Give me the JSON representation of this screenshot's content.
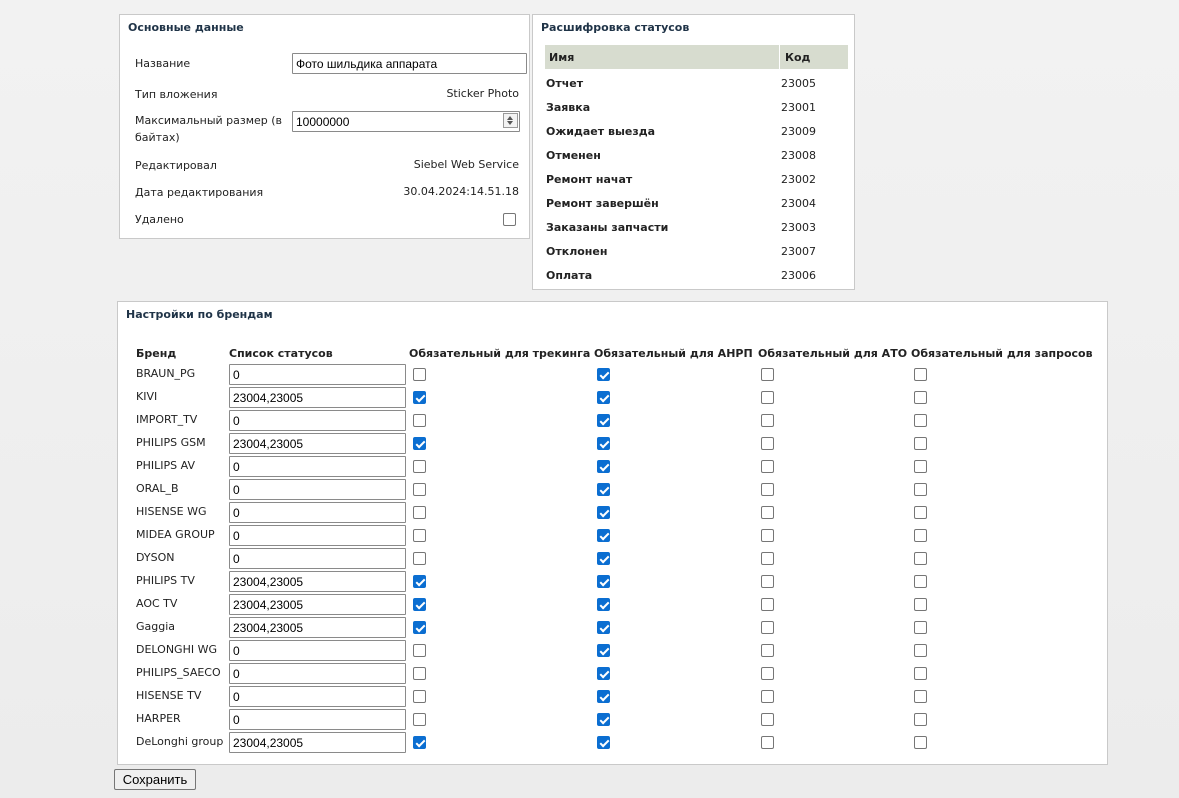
{
  "main": {
    "title": "Основные данные",
    "name_label": "Название",
    "name_value": "Фото шильдика аппарата",
    "type_label": "Тип вложения",
    "type_value": "Sticker Photo",
    "size_label": "Максимальный размер (в байтах)",
    "size_value": "10000000",
    "editor_label": "Редактировал",
    "editor_value": "Siebel Web Service",
    "date_label": "Дата редактирования",
    "date_value": "30.04.2024:14.51.18",
    "deleted_label": "Удалено",
    "deleted_checked": false
  },
  "status": {
    "title": "Расшифровка статусов",
    "col_name": "Имя",
    "col_code": "Код",
    "rows": [
      {
        "name": "Отчет",
        "code": "23005"
      },
      {
        "name": "Заявка",
        "code": "23001"
      },
      {
        "name": "Ожидает выезда",
        "code": "23009"
      },
      {
        "name": "Отменен",
        "code": "23008"
      },
      {
        "name": "Ремонт начат",
        "code": "23002"
      },
      {
        "name": "Ремонт завершён",
        "code": "23004"
      },
      {
        "name": "Заказаны запчасти",
        "code": "23003"
      },
      {
        "name": "Отклонен",
        "code": "23007"
      },
      {
        "name": "Оплата",
        "code": "23006"
      }
    ]
  },
  "brands": {
    "title": "Настройки по брендам",
    "headers": {
      "brand": "Бренд",
      "statuses": "Список статусов",
      "tracking": "Обязательный для трекинга",
      "anrp": "Обязательный для АНРП",
      "ato": "Обязательный для АТО",
      "requests": "Обязательный для запросов"
    },
    "rows": [
      {
        "brand": "BRAUN_PG",
        "statuses": "0",
        "tracking": false,
        "anrp": true,
        "ato": false,
        "requests": false
      },
      {
        "brand": "KIVI",
        "statuses": "23004,23005",
        "tracking": true,
        "anrp": true,
        "ato": false,
        "requests": false
      },
      {
        "brand": "IMPORT_TV",
        "statuses": "0",
        "tracking": false,
        "anrp": true,
        "ato": false,
        "requests": false
      },
      {
        "brand": "PHILIPS GSM",
        "statuses": "23004,23005",
        "tracking": true,
        "anrp": true,
        "ato": false,
        "requests": false
      },
      {
        "brand": "PHILIPS AV",
        "statuses": "0",
        "tracking": false,
        "anrp": true,
        "ato": false,
        "requests": false
      },
      {
        "brand": "ORAL_B",
        "statuses": "0",
        "tracking": false,
        "anrp": true,
        "ato": false,
        "requests": false
      },
      {
        "brand": "HISENSE WG",
        "statuses": "0",
        "tracking": false,
        "anrp": true,
        "ato": false,
        "requests": false
      },
      {
        "brand": "MIDEA GROUP",
        "statuses": "0",
        "tracking": false,
        "anrp": true,
        "ato": false,
        "requests": false
      },
      {
        "brand": "DYSON",
        "statuses": "0",
        "tracking": false,
        "anrp": true,
        "ato": false,
        "requests": false
      },
      {
        "brand": "PHILIPS TV",
        "statuses": "23004,23005",
        "tracking": true,
        "anrp": true,
        "ato": false,
        "requests": false
      },
      {
        "brand": "AOC TV",
        "statuses": "23004,23005",
        "tracking": true,
        "anrp": true,
        "ato": false,
        "requests": false
      },
      {
        "brand": "Gaggia",
        "statuses": "23004,23005",
        "tracking": true,
        "anrp": true,
        "ato": false,
        "requests": false
      },
      {
        "brand": "DELONGHI WG",
        "statuses": "0",
        "tracking": false,
        "anrp": true,
        "ato": false,
        "requests": false
      },
      {
        "brand": "PHILIPS_SAECO",
        "statuses": "0",
        "tracking": false,
        "anrp": true,
        "ato": false,
        "requests": false
      },
      {
        "brand": "HISENSE TV",
        "statuses": "0",
        "tracking": false,
        "anrp": true,
        "ato": false,
        "requests": false
      },
      {
        "brand": "HARPER",
        "statuses": "0",
        "tracking": false,
        "anrp": true,
        "ato": false,
        "requests": false
      },
      {
        "brand": "DeLonghi group",
        "statuses": "23004,23005",
        "tracking": true,
        "anrp": true,
        "ato": false,
        "requests": false
      }
    ]
  },
  "save_label": "Сохранить",
  "colors": {
    "accent": "#0b6ed1",
    "title": "#1f3347",
    "table_header": "#d7dccf"
  }
}
